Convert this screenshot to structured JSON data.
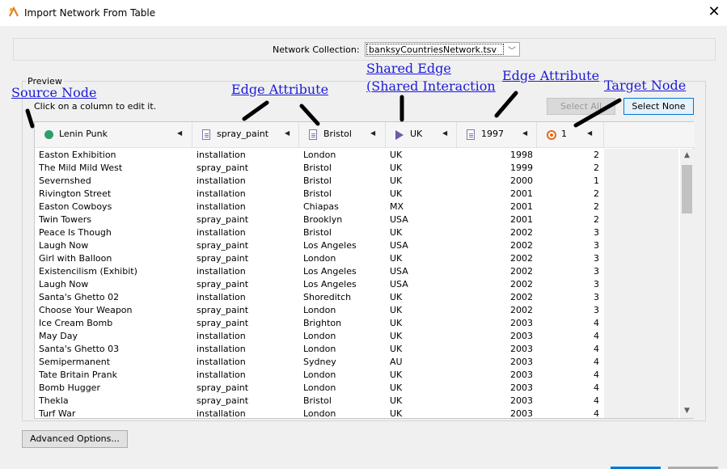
{
  "window": {
    "title": "Import Network From Table",
    "close_glyph": "✕",
    "icon": "app-icon"
  },
  "collection": {
    "label": "Network Collection:",
    "selected": "banksyCountriesNetwork.tsv"
  },
  "preview": {
    "legend": "Preview",
    "hint": "Click on a column to edit it.",
    "select_all": "Select All",
    "select_none": "Select None"
  },
  "columns": [
    {
      "name": "Lenin Punk",
      "icon": "source-node-icon"
    },
    {
      "name": "spray_paint",
      "icon": "edge-attribute-icon"
    },
    {
      "name": "Bristol",
      "icon": "edge-attribute-icon"
    },
    {
      "name": "UK",
      "icon": "interaction-icon"
    },
    {
      "name": "1997",
      "icon": "edge-attribute-icon"
    },
    {
      "name": "1",
      "icon": "target-node-icon"
    }
  ],
  "rows": [
    [
      "Easton Exhibition",
      "installation",
      "London",
      "UK",
      "1998",
      "2"
    ],
    [
      "The Mild Mild West",
      "spray_paint",
      "Bristol",
      "UK",
      "1999",
      "2"
    ],
    [
      "Severnshed",
      "installation",
      "Bristol",
      "UK",
      "2000",
      "1"
    ],
    [
      "Rivington Street",
      "installation",
      "Bristol",
      "UK",
      "2001",
      "2"
    ],
    [
      "Easton Cowboys",
      "installation",
      "Chiapas",
      "MX",
      "2001",
      "2"
    ],
    [
      "Twin Towers",
      "spray_paint",
      "Brooklyn",
      "USA",
      "2001",
      "2"
    ],
    [
      "Peace Is Though",
      "installation",
      "Bristol",
      "UK",
      "2002",
      "3"
    ],
    [
      "Laugh Now",
      "spray_paint",
      "Los Angeles",
      "USA",
      "2002",
      "3"
    ],
    [
      "Girl with Balloon",
      "spray_paint",
      "London",
      "UK",
      "2002",
      "3"
    ],
    [
      "Existencilism (Exhibit)",
      "installation",
      "Los Angeles",
      "USA",
      "2002",
      "3"
    ],
    [
      "Laugh Now",
      "spray_paint",
      "Los Angeles",
      "USA",
      "2002",
      "3"
    ],
    [
      "Santa's Ghetto 02",
      "installation",
      "Shoreditch",
      "UK",
      "2002",
      "3"
    ],
    [
      "Choose Your Weapon",
      "spray_paint",
      "London",
      "UK",
      "2002",
      "3"
    ],
    [
      "Ice Cream Bomb",
      "spray_paint",
      "Brighton",
      "UK",
      "2003",
      "4"
    ],
    [
      "May Day",
      "installation",
      "London",
      "UK",
      "2003",
      "4"
    ],
    [
      "Santa's Ghetto 03",
      "installation",
      "London",
      "UK",
      "2003",
      "4"
    ],
    [
      "Semipermanent",
      "installation",
      "Sydney",
      "AU",
      "2003",
      "4"
    ],
    [
      "Tate Britain Prank",
      "installation",
      "London",
      "UK",
      "2003",
      "4"
    ],
    [
      "Bomb Hugger",
      "spray_paint",
      "London",
      "UK",
      "2003",
      "4"
    ],
    [
      "Thekla",
      "spray_paint",
      "Bristol",
      "UK",
      "2003",
      "4"
    ],
    [
      "Turf War",
      "installation",
      "London",
      "UK",
      "2003",
      "4"
    ]
  ],
  "annotations": {
    "source_node": "Source Node",
    "edge_attr_1": "Edge Attribute",
    "shared_edge_1": "Shared Edge",
    "shared_edge_2": "(Shared Interaction",
    "edge_attr_2": "Edge Attribute",
    "target_node": "Target Node"
  },
  "footer": {
    "advanced": "Advanced Options..."
  },
  "colors": {
    "annotation": "#1a1ad8",
    "source_node": "#2e9e6a",
    "interaction": "#6f5aa8",
    "target_node": "#e06a1e"
  }
}
